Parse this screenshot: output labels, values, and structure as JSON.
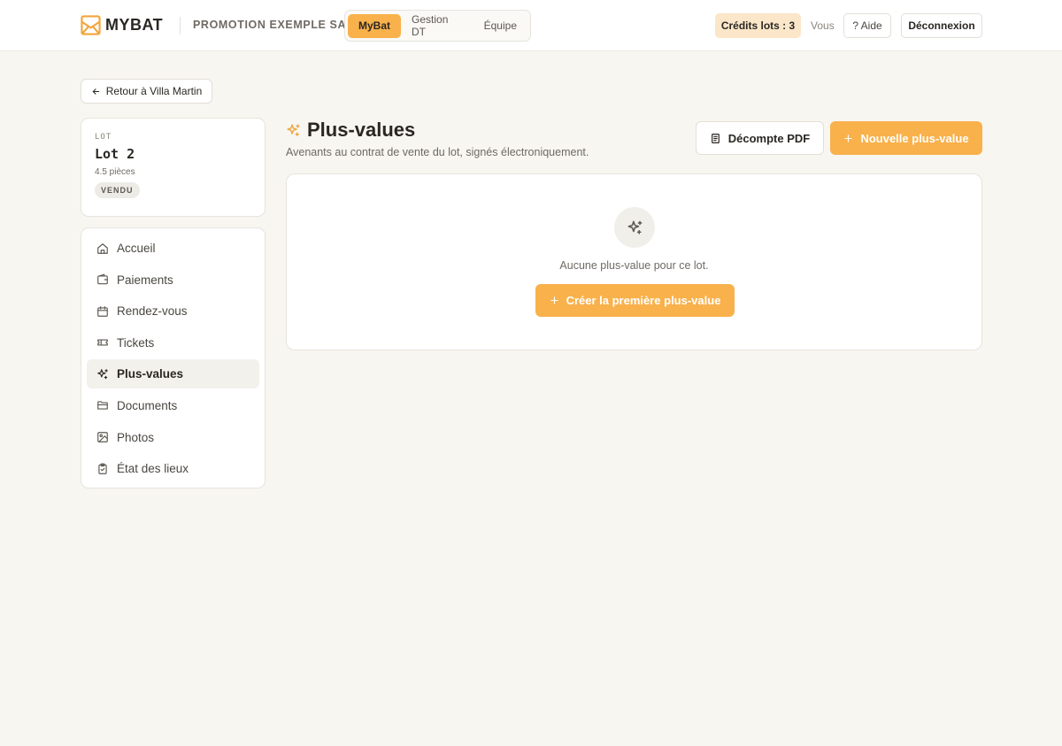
{
  "header": {
    "brand": "MYBAT",
    "organization": "PROMOTION EXEMPLE SA",
    "app_tabs": [
      {
        "label": "MyBat",
        "active": true
      },
      {
        "label": "Gestion DT",
        "active": false
      },
      {
        "label": "Équipe",
        "active": false
      }
    ],
    "credits_label": "Crédits lots : 3",
    "user_label": "Vous",
    "help_label": "? Aide",
    "logout_label": "Déconnexion"
  },
  "back_link": {
    "label": "Retour à Villa Martin",
    "icon": "arrow-left-icon"
  },
  "lot_card": {
    "kicker": "LOT",
    "title": "Lot 2",
    "subtitle": "4.5 pièces",
    "status_badge": "VENDU"
  },
  "sidebar": {
    "items": [
      {
        "label": "Accueil",
        "icon": "home-icon",
        "active": false
      },
      {
        "label": "Paiements",
        "icon": "wallet-icon",
        "active": false
      },
      {
        "label": "Rendez-vous",
        "icon": "calendar-icon",
        "active": false
      },
      {
        "label": "Tickets",
        "icon": "ticket-icon",
        "active": false
      },
      {
        "label": "Plus-values",
        "icon": "sparkles-icon",
        "active": true
      },
      {
        "label": "Documents",
        "icon": "folder-icon",
        "active": false
      },
      {
        "label": "Photos",
        "icon": "image-icon",
        "active": false
      },
      {
        "label": "État des lieux",
        "icon": "clipboard-check-icon",
        "active": false
      }
    ]
  },
  "main": {
    "title": "Plus-values",
    "title_icon": "sparkles-icon",
    "subtitle": "Avenants au contrat de vente du lot, signés électroniquement.",
    "pdf_button_label": "Décompte PDF",
    "new_button_label": "Nouvelle plus-value",
    "empty_state": {
      "icon": "sparkles-icon",
      "message": "Aucune plus-value pour ce lot.",
      "cta_label": "Créer la première plus-value"
    }
  },
  "colors": {
    "accent": "#f9b14b",
    "credits_bg": "#fbe6c9",
    "background": "#f7f6f1",
    "text": "#2a2723",
    "muted": "#6f6a63"
  }
}
